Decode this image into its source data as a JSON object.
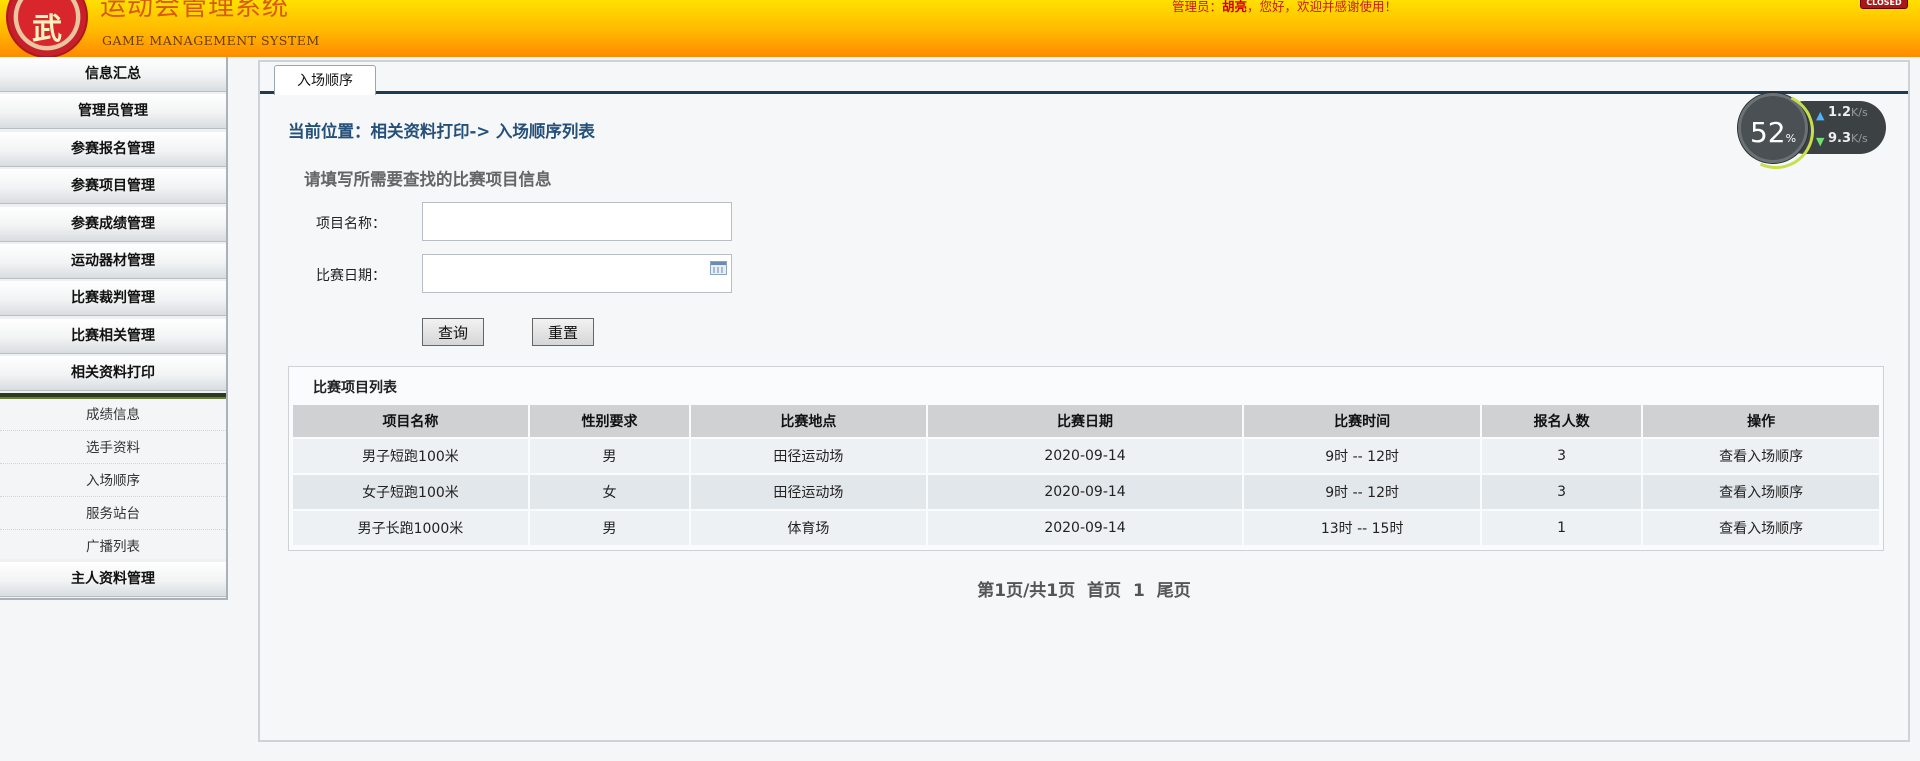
{
  "header": {
    "logo_char": "武",
    "title": "运动会管理系统",
    "subtitle": "GAME MANAGEMENT SYSTEM",
    "admin_prefix": "管理员：",
    "admin_name": "胡亮",
    "admin_suffix": "，您好，欢迎并感谢使用！",
    "close_label": "CLOSED"
  },
  "sidebar": {
    "items": [
      {
        "label": "信息汇总"
      },
      {
        "label": "管理员管理"
      },
      {
        "label": "参赛报名管理"
      },
      {
        "label": "参赛项目管理"
      },
      {
        "label": "参赛成绩管理"
      },
      {
        "label": "运动器材管理"
      },
      {
        "label": "比赛裁判管理"
      },
      {
        "label": "比赛相关管理"
      },
      {
        "label": "相关资料打印"
      }
    ],
    "subitems": [
      {
        "label": "成绩信息"
      },
      {
        "label": "选手资料"
      },
      {
        "label": "入场顺序"
      },
      {
        "label": "服务站台"
      },
      {
        "label": "广播列表"
      }
    ],
    "last_item": {
      "label": "主人资料管理"
    }
  },
  "main": {
    "tab_label": "入场顺序",
    "breadcrumb": "当前位置：相关资料打印-> 入场顺序列表",
    "form": {
      "title": "请填写所需要查找的比赛项目信息",
      "name_label": "项目名称：",
      "name_value": "",
      "date_label": "比赛日期：",
      "date_value": "",
      "query_label": "查询",
      "reset_label": "重置"
    },
    "list": {
      "title": "比赛项目列表",
      "columns": [
        "项目名称",
        "性别要求",
        "比赛地点",
        "比赛日期",
        "比赛时间",
        "报名人数",
        "操作"
      ],
      "rows": [
        [
          "男子短跑100米",
          "男",
          "田径运动场",
          "2020-09-14",
          "9时 -- 12时",
          "3",
          "查看入场顺序"
        ],
        [
          "女子短跑100米",
          "女",
          "田径运动场",
          "2020-09-14",
          "9时 -- 12时",
          "3",
          "查看入场顺序"
        ],
        [
          "男子长跑1000米",
          "男",
          "体育场",
          "2020-09-14",
          "13时 -- 15时",
          "1",
          "查看入场顺序"
        ]
      ]
    },
    "pagination": {
      "info": "第1页/共1页",
      "first": "首页",
      "current": "1",
      "last": "尾页"
    }
  },
  "net_widget": {
    "percent": "52",
    "percent_unit": "%",
    "upload": "1.2",
    "download": "9.3",
    "unit": "K/s"
  }
}
